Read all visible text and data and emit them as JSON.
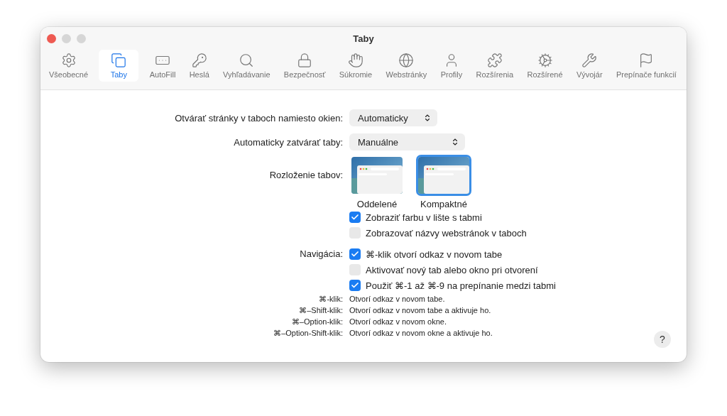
{
  "window": {
    "title": "Taby"
  },
  "toolbar": [
    {
      "label": "Všeobecné",
      "selected": false
    },
    {
      "label": "Taby",
      "selected": true
    },
    {
      "label": "AutoFill",
      "selected": false
    },
    {
      "label": "Heslá",
      "selected": false
    },
    {
      "label": "Vyhľadávanie",
      "selected": false
    },
    {
      "label": "Bezpečnosť",
      "selected": false
    },
    {
      "label": "Súkromie",
      "selected": false
    },
    {
      "label": "Webstránky",
      "selected": false
    },
    {
      "label": "Profily",
      "selected": false
    },
    {
      "label": "Rozšírenia",
      "selected": false
    },
    {
      "label": "Rozšírené",
      "selected": false
    },
    {
      "label": "Vývojár",
      "selected": false
    },
    {
      "label": "Prepínače funkcií",
      "selected": false
    }
  ],
  "popups": [
    {
      "label": "Otvárať stránky v taboch namiesto okien:",
      "value": "Automaticky"
    },
    {
      "label": "Automaticky zatvárať taby:",
      "value": "Manuálne"
    }
  ],
  "tab_layout": {
    "label": "Rozloženie tabov:",
    "options": [
      {
        "label": "Oddelené",
        "selected": false
      },
      {
        "label": "Kompaktné",
        "selected": true
      }
    ]
  },
  "tab_options": [
    {
      "label": "Zobraziť farbu v lište s tabmi",
      "checked": true
    },
    {
      "label": "Zobrazovať názvy webstránok v taboch",
      "checked": false
    }
  ],
  "navigation": {
    "label": "Navigácia:",
    "options": [
      {
        "label": "⌘-klik otvorí odkaz v novom tabe",
        "checked": true
      },
      {
        "label": "Aktivovať nový tab alebo okno pri otvorení",
        "checked": false
      },
      {
        "label": "Použiť ⌘-1 až ⌘-9 na prepínanie medzi tabmi",
        "checked": true
      }
    ]
  },
  "shortcuts": [
    {
      "keys": "⌘-klik:",
      "description": "Otvorí odkaz v novom tabe."
    },
    {
      "keys": "⌘–Shift-klik:",
      "description": "Otvorí odkaz v novom tabe a aktivuje ho."
    },
    {
      "keys": "⌘–Option-klik:",
      "description": "Otvorí odkaz v novom okne."
    },
    {
      "keys": "⌘–Option-Shift-klik:",
      "description": "Otvorí odkaz v novom okne a aktivuje ho."
    }
  ],
  "help_button": "?"
}
